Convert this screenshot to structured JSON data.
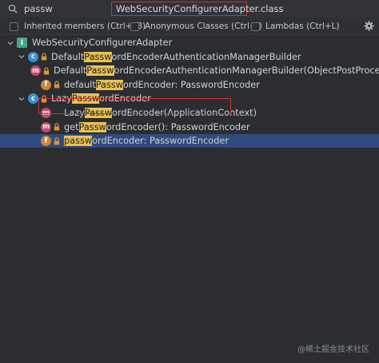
{
  "search": {
    "query": "passw"
  },
  "header": {
    "file_title": "WebSecurityConfigurerAdapter.class"
  },
  "options": [
    {
      "label": "Inherited members (Ctrl+F3)"
    },
    {
      "label": "Anonymous Classes (Ctrl+I)"
    },
    {
      "label": "Lambdas (Ctrl+L)"
    }
  ],
  "tree": [
    {
      "id": "root",
      "depth": 0,
      "icon": "interface-icon",
      "chevron": "down",
      "parts": [
        {
          "t": "WebSecurityConfigurerAdapter",
          "h": false
        }
      ]
    },
    {
      "id": "defbuilder",
      "depth": 1,
      "icon": "class-icon",
      "chevron": "down",
      "vis": "lock-icon",
      "parts": [
        {
          "t": "Default",
          "h": false
        },
        {
          "t": "Passw",
          "h": true
        },
        {
          "t": "ordEncoderAuthenticationManagerBuilder",
          "h": false
        }
      ]
    },
    {
      "id": "defbuilder-ctor",
      "depth": 2,
      "icon": "method-icon",
      "vis": "lock-icon",
      "parts": [
        {
          "t": "Default",
          "h": false
        },
        {
          "t": "Passw",
          "h": true
        },
        {
          "t": "ordEncoderAuthenticationManagerBuilder(ObjectPostProcessor",
          "h": false
        }
      ]
    },
    {
      "id": "defbuilder-field",
      "depth": 2,
      "icon": "field-icon",
      "vis": "lock-icon",
      "parts": [
        {
          "t": "default",
          "h": false
        },
        {
          "t": "Passw",
          "h": true
        },
        {
          "t": "ordEncoder: PasswordEncoder",
          "h": false
        }
      ]
    },
    {
      "id": "lazy",
      "depth": 1,
      "icon": "class-icon",
      "chevron": "down",
      "vis": "lock-icon",
      "parts": [
        {
          "t": "Lazy",
          "h": false
        },
        {
          "t": "Passw",
          "h": true
        },
        {
          "t": "ordEncoder",
          "h": false
        }
      ]
    },
    {
      "id": "lazy-ctor",
      "depth": 2,
      "icon": "method-icon",
      "vis": "none",
      "parts": [
        {
          "t": "Lazy",
          "h": false
        },
        {
          "t": "Passw",
          "h": true
        },
        {
          "t": "ordEncoder(ApplicationContext)",
          "h": false
        }
      ]
    },
    {
      "id": "lazy-getter",
      "depth": 2,
      "icon": "method-icon",
      "vis": "lock-icon",
      "parts": [
        {
          "t": "get",
          "h": false
        },
        {
          "t": "Passw",
          "h": true
        },
        {
          "t": "ordEncoder(): PasswordEncoder",
          "h": false
        }
      ]
    },
    {
      "id": "lazy-field",
      "depth": 2,
      "icon": "field-icon",
      "vis": "lock-icon",
      "selected": true,
      "parts": [
        {
          "t": "passw",
          "h": true
        },
        {
          "t": "ordEncoder: PasswordEncoder",
          "h": false
        }
      ]
    }
  ],
  "watermark": "@稀土掘金技术社区",
  "colors": {
    "selection": "#2f4a7c",
    "highlight": "#e9c255",
    "redbox": "#d0312d"
  }
}
